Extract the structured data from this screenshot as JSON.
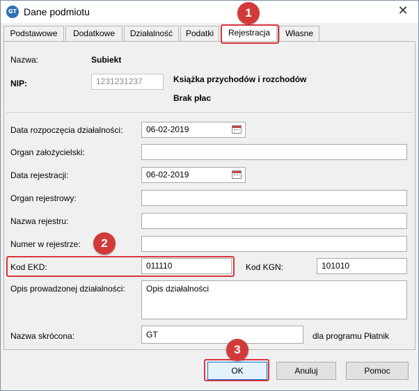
{
  "window": {
    "title": "Dane podmiotu",
    "app_icon_text": "GT",
    "close_glyph": "✕"
  },
  "tabs": [
    {
      "label": "Podstawowe"
    },
    {
      "label": "Dodatkowe"
    },
    {
      "label": "Działalność"
    },
    {
      "label": "Podatki"
    },
    {
      "label": "Rejestracja"
    },
    {
      "label": "Własne"
    }
  ],
  "active_tab": "Rejestracja",
  "header": {
    "name_label": "Nazwa:",
    "name_value": "Subiekt",
    "nip_label": "NIP:",
    "nip_value": "1231231237",
    "ledger": "Książka przychodów i rozchodów",
    "payroll": "Brak płac"
  },
  "form": {
    "start_date_label": "Data rozpoczęcia działalności:",
    "start_date_value": "06-02-2019",
    "founding_body_label": "Organ założycielski:",
    "founding_body_value": "",
    "reg_date_label": "Data rejestracji:",
    "reg_date_value": "06-02-2019",
    "reg_body_label": "Organ rejestrowy:",
    "reg_body_value": "",
    "register_name_label": "Nazwa rejestru:",
    "register_name_value": "",
    "register_number_label": "Numer w rejestrze:",
    "register_number_value": "",
    "ekd_label": "Kod EKD:",
    "ekd_value": "011110",
    "kgn_label": "Kod KGN:",
    "kgn_value": "101010",
    "activity_desc_label": "Opis prowadzonej działalności:",
    "activity_desc_value": "Opis działalności",
    "short_name_label": "Nazwa skrócona:",
    "short_name_value": "GT",
    "short_name_note": "dla programu Płatnik"
  },
  "buttons": {
    "ok": "OK",
    "cancel": "Anuluj",
    "help": "Pomoc"
  },
  "annotations": {
    "badge1": "1",
    "badge2": "2",
    "badge3": "3",
    "color": "#d23a3a"
  }
}
